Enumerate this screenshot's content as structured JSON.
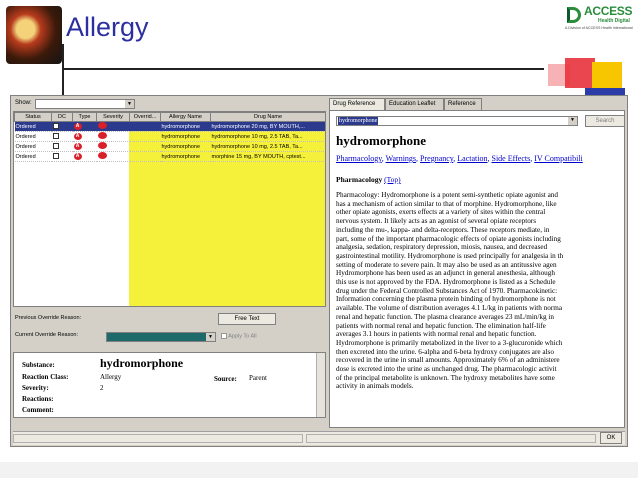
{
  "slide": {
    "title": "Allergy",
    "logo": {
      "name": "ACCESS",
      "sub": "Health Digital",
      "tagline": "A Division of ACCESS Health International"
    }
  },
  "app": {
    "show_label": "Show:",
    "grid": {
      "headers": [
        "Status",
        "DC",
        "Type",
        "Severity",
        "Overrid...",
        "Allergy Name",
        "Drug Name"
      ],
      "rows": [
        {
          "status": "Ordered",
          "type": "A",
          "allergy": "hydromorphone",
          "drug": "hydromorphone 20 mg, BY MOUTH,...",
          "selected": true
        },
        {
          "status": "Ordered",
          "type": "A",
          "allergy": "hydromorphone",
          "drug": "hydromorphone 10 mg, 2.5 TAB, Ta...",
          "selected": false
        },
        {
          "status": "Ordered",
          "type": "A",
          "allergy": "hydromorphone",
          "drug": "hydromorphone 10 mg, 2.5 TAB, Ta...",
          "selected": false
        },
        {
          "status": "Ordered",
          "type": "A",
          "allergy": "hydromorphone",
          "drug": "morphine 15 mg, BY MOUTH, cptest...",
          "selected": false
        }
      ]
    },
    "override": {
      "previous_label": "Previous Override Reason:",
      "current_label": "Current Override Reason:",
      "free_text_button": "Free Text",
      "apply_to_all": "Apply To All"
    },
    "details": {
      "substance_label": "Substance:",
      "substance_value": "hydromorphone",
      "reaction_class_label": "Reaction Class:",
      "reaction_class_value": "Allergy",
      "source_label": "Source:",
      "source_value": "Parent",
      "severity_label": "Severity:",
      "severity_value": "2",
      "reactions_label": "Reactions:",
      "comment_label": "Comment:"
    },
    "reference": {
      "tabs": [
        "Drug Reference",
        "Education Leaflet",
        "Reference"
      ],
      "drug_select": "hydromorphone",
      "search_button": "Search",
      "drug_title": "hydromorphone",
      "nav_links": [
        "Pharmacology",
        "Warnings",
        "Pregnancy",
        "Lactation",
        "Side Effects",
        "IV Compatibili"
      ],
      "section_title": "Pharmacology",
      "section_top_link": "(Top)",
      "body_lines": [
        "Pharmacology: Hydromorphone is a potent semi-synthetic opiate agonist and",
        "has a mechanism of action similar to that of morphine. Hydromorphone, like",
        "other opiate agonists, exerts effects at a variety of sites within the central",
        "nervous system. It likely acts as an agonist of several opiate receptors",
        "including the mu-, kappa- and delta-receptors. These receptors mediate, in",
        "part, some of the important pharmacologic effects of opiate agonists including",
        "analgesia, sedation, respiratory depression, miosis, nausea, and decreased",
        "gastrointestinal motility. Hydromorphone is used principally for analgesia in th",
        "setting of moderate to severe pain. It may also be used as an antitussive agen",
        "Hydromorphone has been used as an adjunct in general anesthesia, although",
        "this use is not approved by the FDA. Hydromorphone is listed as a Schedule",
        "drug under the Federal Controlled Substances Act of 1970. Pharmacokinetic:",
        "Information concerning the plasma protein binding of hydromorphone is not",
        "available. The volume of distribution averages 4.1 L/kg in patients with norma",
        "renal and hepatic function. The plasma clearance averages 23 mL/min/kg in",
        "patients with normal renal and hepatic function. The elimination half-life",
        "averages 3.1 hours in patients with normal renal and hepatic function.",
        "Hydromorphone is primarily metabolized in the liver to a 3-glucuronide which",
        "then excreted into the urine. 6-alpha and 6-beta hydroxy conjugates are also",
        "recovered in the urine in small amounts. Approximately 6% of an administere",
        "dose is excreted into the urine as unchanged drug. The pharmacologic activit",
        "of the principal metabolite is unknown. The hydroxy metabolites have some",
        "activity in animals models."
      ]
    },
    "ok_button": "OK"
  },
  "colors": {
    "title": "#2b2fa0",
    "selection": "#2c3a8e",
    "highlight": "#f5f03a",
    "alert": "#d8202a"
  }
}
